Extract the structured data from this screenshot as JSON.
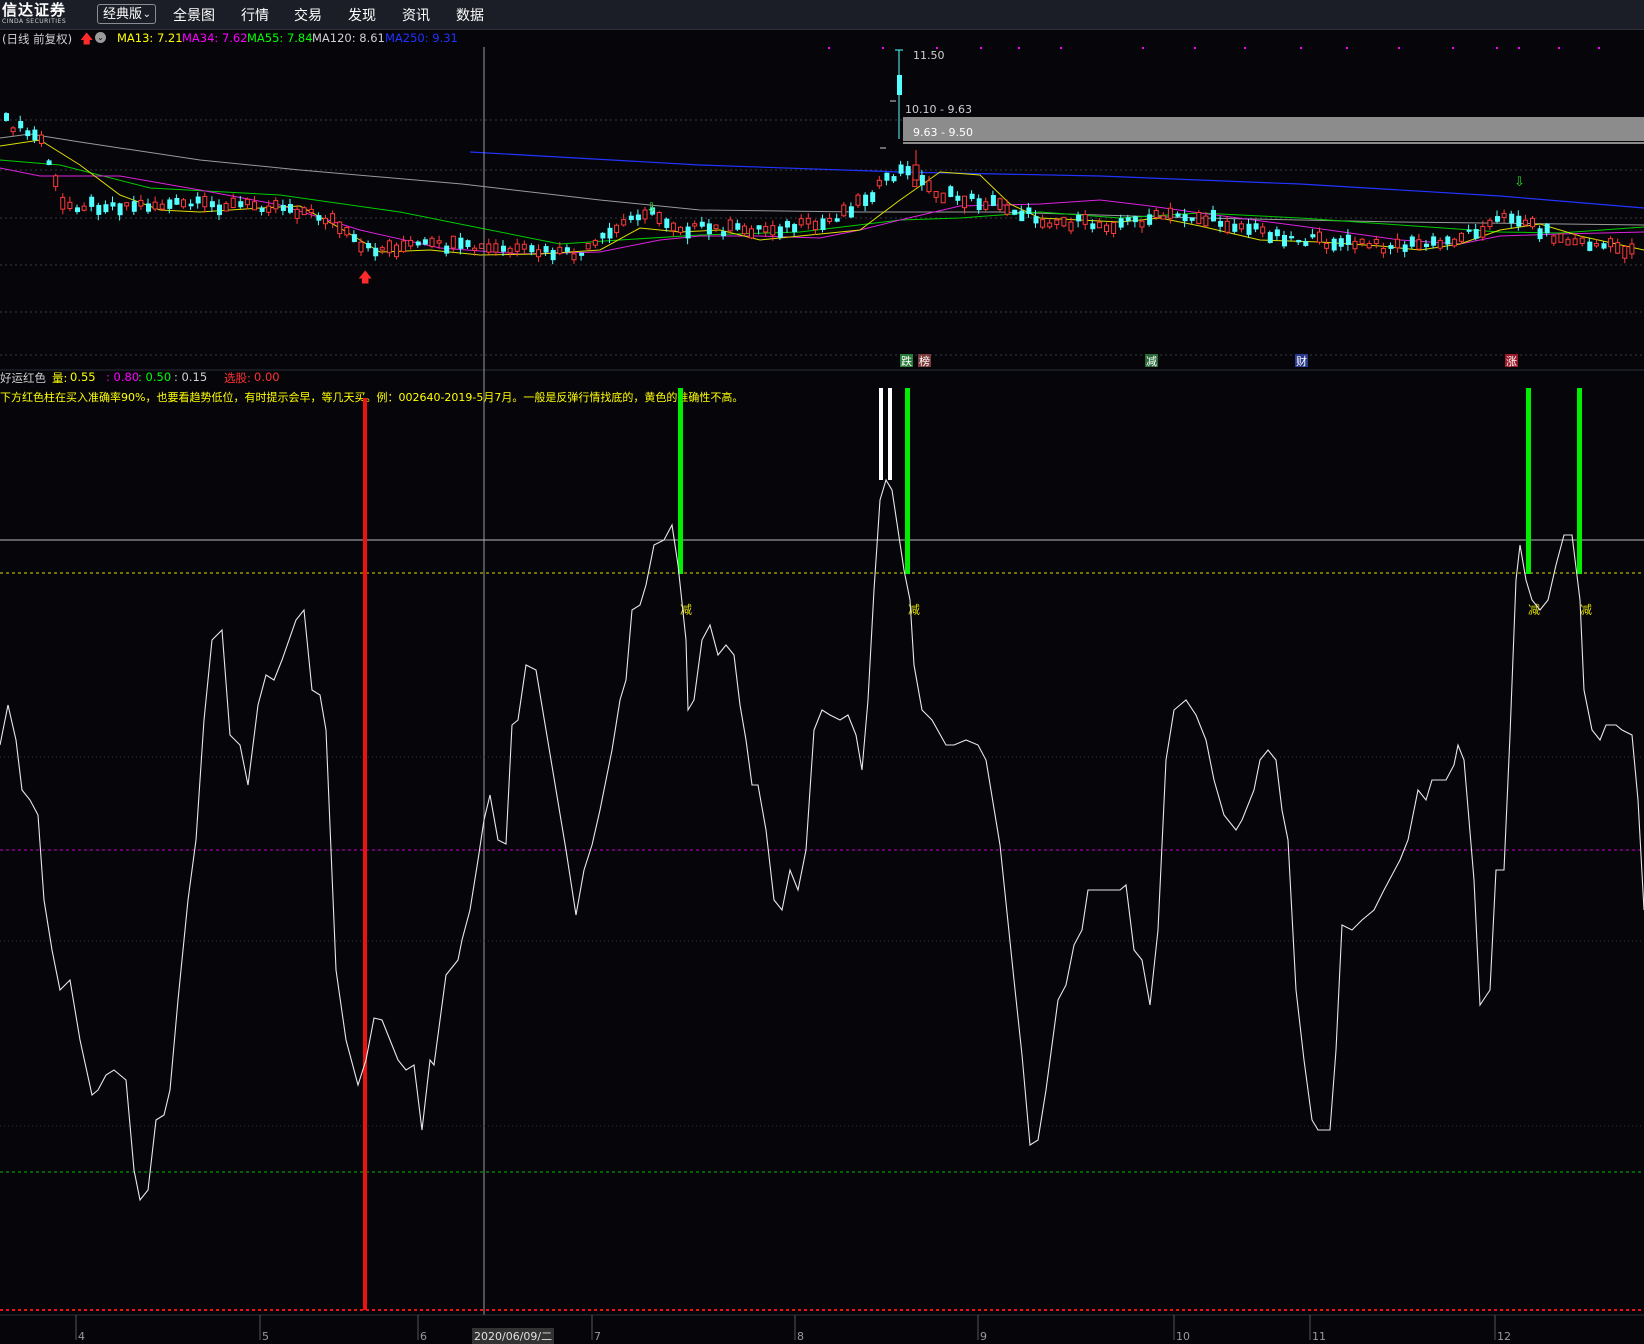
{
  "app": {
    "logo_cn": "信达证券",
    "logo_en": "CINDA SECURITIES",
    "edition": "经典版",
    "menu": [
      "全景图",
      "行情",
      "交易",
      "发现",
      "资讯",
      "数据"
    ]
  },
  "price_panel": {
    "title": "(日线 前复权)",
    "ma": [
      {
        "label": "MA13:",
        "value": "7.21",
        "color": "#ffff00"
      },
      {
        "label": "MA34:",
        "value": "7.62",
        "color": "#ff00ff"
      },
      {
        "label": "MA55:",
        "value": "7.84",
        "color": "#00ff00"
      },
      {
        "label": "MA120:",
        "value": "8.61",
        "color": "#d0d0d0"
      },
      {
        "label": "MA250:",
        "value": "9.31",
        "color": "#2233ff"
      }
    ],
    "high_label": "11.50",
    "zone_label_1": "10.10 - 9.63",
    "zone_label_2": "9.63 - 9.50",
    "event_tags": [
      {
        "text": "跌",
        "color": "#ffffff",
        "bg": "#2a7a3a"
      },
      {
        "text": "榜",
        "color": "#ffffff",
        "bg": "#7a3a3a"
      },
      {
        "text": "减",
        "color": "#ffffff",
        "bg": "#2a6a3a"
      },
      {
        "text": "财",
        "color": "#ffffff",
        "bg": "#2a3a8a"
      },
      {
        "text": "涨",
        "color": "#ffffff",
        "bg": "#9a1a2a"
      }
    ]
  },
  "indicator_panel": {
    "name": "好运红色",
    "vol_label": "量:",
    "values": [
      {
        "text": "0.55",
        "color": "#ffff00"
      },
      {
        "text": "0.80",
        "color": "#ff00ff"
      },
      {
        "text": "0.50",
        "color": "#00ff00"
      },
      {
        "text": "0.15",
        "color": "#d0d0d0"
      }
    ],
    "pick_label": "选股:",
    "pick_value": "0.00",
    "note": "下方红色柱在买入准确率90%，也要看趋势低位，有时提示会早，等几天买。例：002640-2019-5月7月。一般是反弹行情找底的，黄色的准确性不高。",
    "reduce_labels": [
      "减",
      "减",
      "减",
      "减"
    ]
  },
  "x_axis": {
    "ticks": [
      "4",
      "5",
      "6",
      "7",
      "8",
      "9",
      "10",
      "11",
      "12"
    ],
    "cursor_date": "2020/06/09/二"
  },
  "colors": {
    "background": "#05050a",
    "up": "#ff3a3a",
    "down": "#54ffff",
    "signal_green": "#00ee00",
    "signal_red": "#ee1111",
    "oscillator": "#e8e8e8"
  }
}
